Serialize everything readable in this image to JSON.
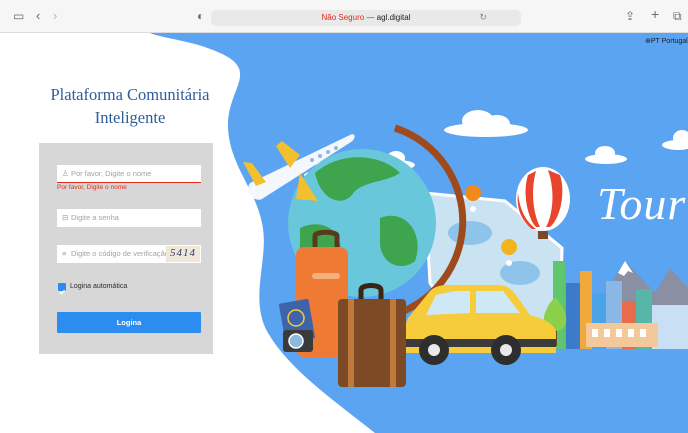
{
  "browser": {
    "url_insecure": "Não Seguro",
    "url_dash": "—",
    "url_host": "agl.digital"
  },
  "header": {
    "language": "PT Portugal"
  },
  "login": {
    "title_line1": "Plataforma Comunitária",
    "title_line2": "Inteligente",
    "username_placeholder": "Por favor, Digite o nome",
    "username_error": "Por favor, Digite o nome",
    "password_placeholder": "Digite a senha",
    "captcha_placeholder": "Digite o código de verificação",
    "captcha_code": "5414",
    "remember_label": "Logina automática",
    "remember_checked": true,
    "submit_label": "Logina"
  },
  "banner": {
    "script_text": "Touris"
  },
  "colors": {
    "sky": "#5aa4f1",
    "accent": "#2d8cf0",
    "error": "#e0301e",
    "title": "#2f5d9a"
  }
}
